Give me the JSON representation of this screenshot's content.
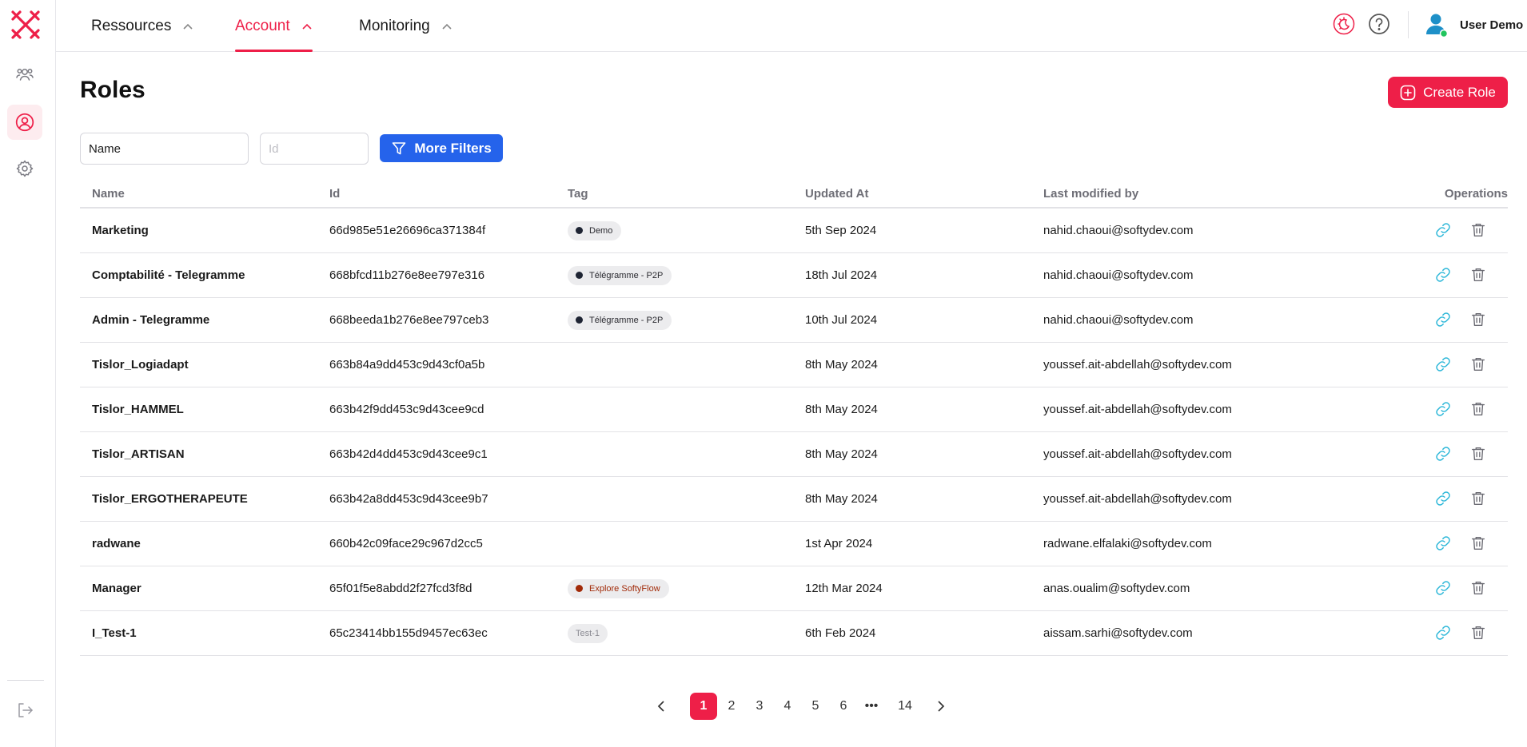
{
  "nav": {
    "items": [
      {
        "label": "Ressources",
        "active": false
      },
      {
        "label": "Account",
        "active": true
      },
      {
        "label": "Monitoring",
        "active": false
      }
    ]
  },
  "user": {
    "name": "User Demo",
    "status_color": "#22c55e"
  },
  "colors": {
    "accent": "#ee1f48",
    "primary": "#2563eb",
    "link": "#29b6d8"
  },
  "page": {
    "title": "Roles"
  },
  "actions": {
    "create_label": "Create Role",
    "more_filters_label": "More Filters"
  },
  "filters": {
    "name_value": "Name",
    "id_placeholder": "Id"
  },
  "table": {
    "headers": {
      "name": "Name",
      "id": "Id",
      "tag": "Tag",
      "updated": "Updated At",
      "modified": "Last modified by",
      "operations": "Operations"
    },
    "rows": [
      {
        "name": "Marketing",
        "id": "66d985e51e26696ca371384f",
        "tag": "Demo",
        "tag_style": "dark",
        "updated": "5th Sep 2024",
        "modified": "nahid.chaoui@softydev.com"
      },
      {
        "name": "Comptabilité - Telegramme",
        "id": "668bfcd11b276e8ee797e316",
        "tag": "Télégramme - P2P",
        "tag_style": "dark",
        "updated": "18th Jul 2024",
        "modified": "nahid.chaoui@softydev.com"
      },
      {
        "name": "Admin - Telegramme",
        "id": "668beeda1b276e8ee797ceb3",
        "tag": "Télégramme - P2P",
        "tag_style": "dark",
        "updated": "10th Jul 2024",
        "modified": "nahid.chaoui@softydev.com"
      },
      {
        "name": "Tislor_Logiadapt",
        "id": "663b84a9dd453c9d43cf0a5b",
        "tag": "",
        "tag_style": "",
        "updated": "8th May 2024",
        "modified": "youssef.ait-abdellah@softydev.com"
      },
      {
        "name": "Tislor_HAMMEL",
        "id": "663b42f9dd453c9d43cee9cd",
        "tag": "",
        "tag_style": "",
        "updated": "8th May 2024",
        "modified": "youssef.ait-abdellah@softydev.com"
      },
      {
        "name": "Tislor_ARTISAN",
        "id": "663b42d4dd453c9d43cee9c1",
        "tag": "",
        "tag_style": "",
        "updated": "8th May 2024",
        "modified": "youssef.ait-abdellah@softydev.com"
      },
      {
        "name": "Tislor_ERGOTHERAPEUTE",
        "id": "663b42a8dd453c9d43cee9b7",
        "tag": "",
        "tag_style": "",
        "updated": "8th May 2024",
        "modified": "youssef.ait-abdellah@softydev.com"
      },
      {
        "name": "radwane",
        "id": "660b42c09face29c967d2cc5",
        "tag": "",
        "tag_style": "",
        "updated": "1st Apr 2024",
        "modified": "radwane.elfalaki@softydev.com"
      },
      {
        "name": "Manager",
        "id": "65f01f5e8abdd2f27fcd3f8d",
        "tag": "Explore SoftyFlow",
        "tag_style": "flow",
        "updated": "12th Mar 2024",
        "modified": "anas.oualim@softydev.com"
      },
      {
        "name": "I_Test-1",
        "id": "65c23414bb155d9457ec63ec",
        "tag": "Test-1",
        "tag_style": "plain",
        "updated": "6th Feb 2024",
        "modified": "aissam.sarhi@softydev.com"
      }
    ]
  },
  "pagination": {
    "pages": [
      "1",
      "2",
      "3",
      "4",
      "5",
      "6",
      "•••",
      "14"
    ],
    "current": "1"
  }
}
